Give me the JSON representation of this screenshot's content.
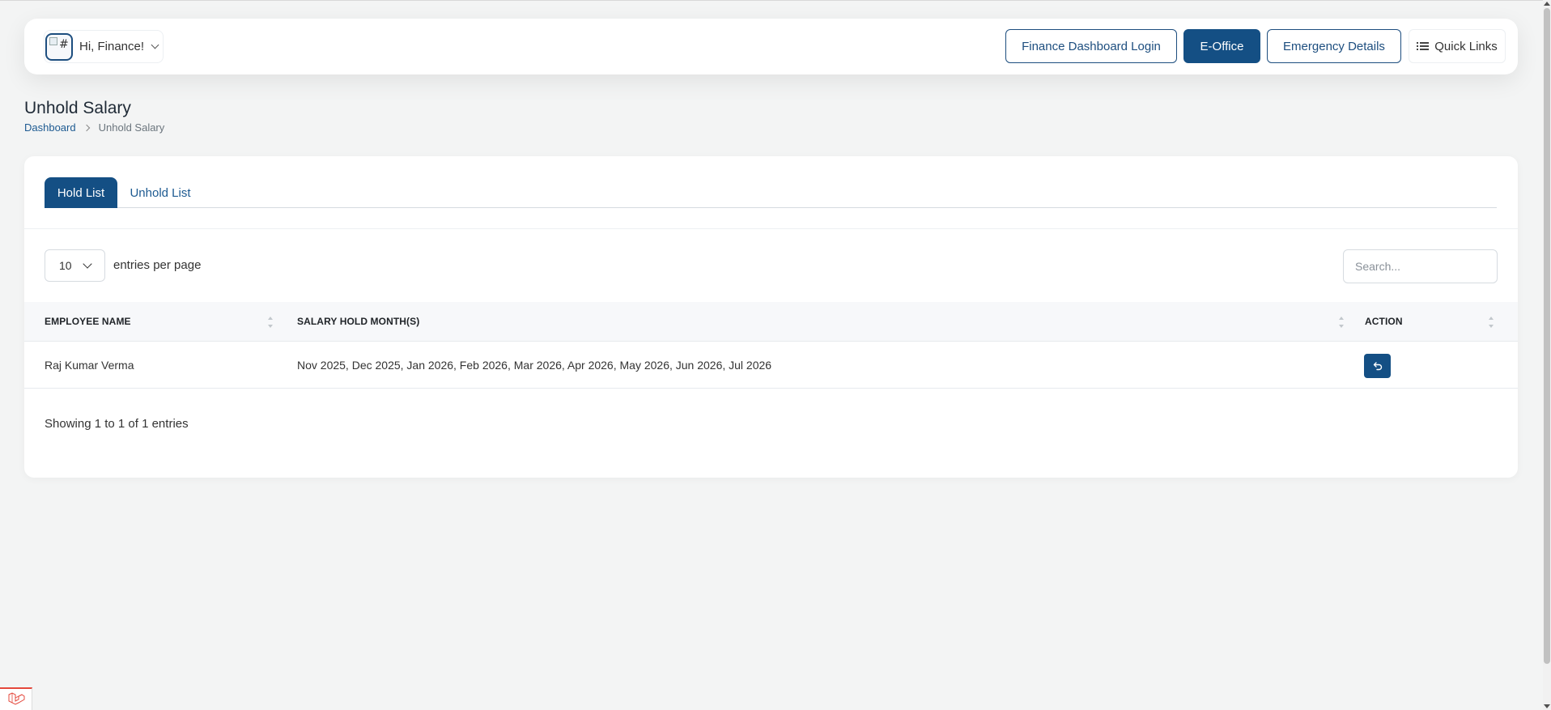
{
  "header": {
    "greeting": "Hi, Finance!",
    "avatar_alt": "#",
    "buttons": {
      "finance_dashboard_login": "Finance Dashboard Login",
      "e_office": "E-Office",
      "emergency_details": "Emergency Details",
      "quick_links": "Quick Links"
    }
  },
  "page": {
    "title": "Unhold Salary",
    "breadcrumb": {
      "root": "Dashboard",
      "current": "Unhold Salary"
    }
  },
  "tabs": [
    {
      "label": "Hold List",
      "active": true
    },
    {
      "label": "Unhold List",
      "active": false
    }
  ],
  "table_controls": {
    "per_page_value": "10",
    "per_page_label": "entries per page",
    "search_placeholder": "Search..."
  },
  "table": {
    "columns": [
      "EMPLOYEE NAME",
      "SALARY HOLD MONTH(S)",
      "ACTION"
    ],
    "rows": [
      {
        "employee_name": "Raj Kumar Verma",
        "hold_months": "Nov 2025, Dec 2025, Jan 2026, Feb 2026, Mar 2026, Apr 2026, May 2026, Jun 2026, Jul 2026",
        "action_icon": "undo-icon"
      }
    ]
  },
  "pagination": {
    "info": "Showing 1 to 1 of 1 entries"
  },
  "colors": {
    "primary": "#144f84",
    "link": "#1d5a91",
    "page_bg": "#f3f4f4",
    "debug_accent": "#e4483c"
  }
}
